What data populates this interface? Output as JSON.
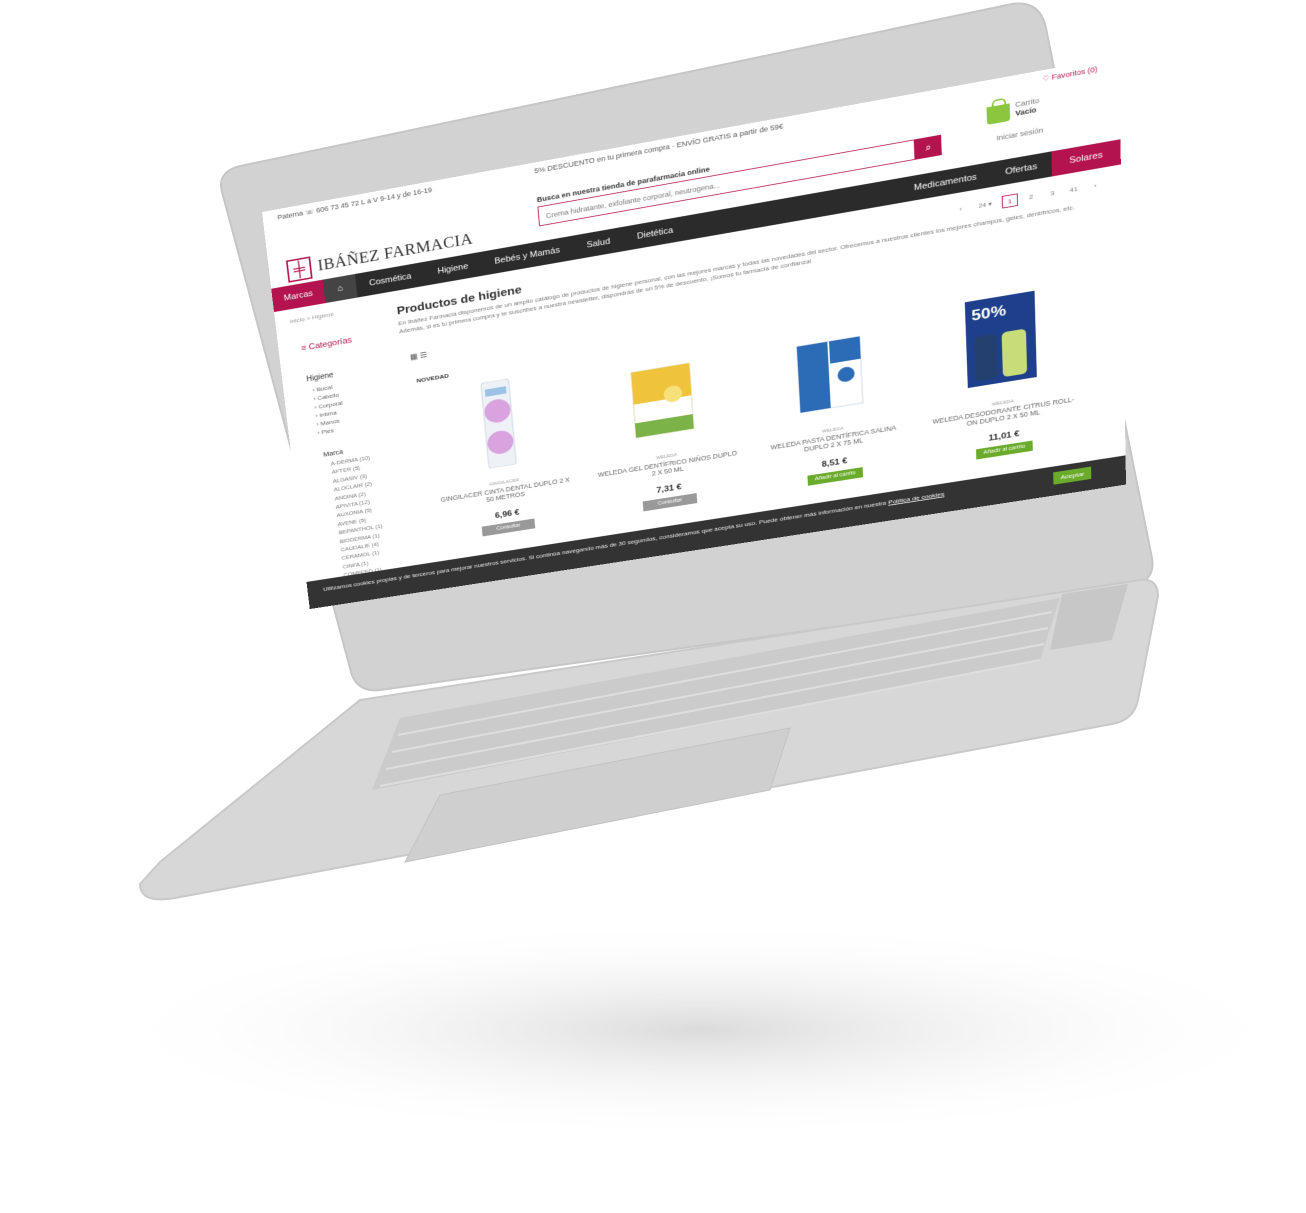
{
  "topbar": {
    "phone": "Paterna ☏ 606 73 45 72 L a V 9-14 y de 16-19",
    "promo": "5% DESCUENTO en tu primera compra · ENVÍO GRATIS a partir de 59€",
    "favorites": "♡ Favoritos (0)"
  },
  "logo": {
    "mark": "╪",
    "text": "IBÁÑEZ FARMACIA"
  },
  "search": {
    "label": "Busca en nuestra tienda de parafarmacia online",
    "placeholder": "Crema hidratante, exfoliante corporal, neutrogena...",
    "button_icon": "search-icon"
  },
  "cart": {
    "title": "Carrito",
    "value": "Vacío",
    "login": "Iniciar sesión"
  },
  "nav": {
    "brands": "Marcas",
    "home_icon": "home-icon",
    "items": [
      "Cosmética",
      "Higiene",
      "Bebés y Mamás",
      "Salud",
      "Dietética"
    ],
    "medicamentos": "Medicamentos",
    "ofertas": "Ofertas",
    "solares": "Solares"
  },
  "breadcrumb": "Inicio  >  Higiene",
  "categories_title": "Categorías",
  "sidebar": {
    "head": "Higiene",
    "items": [
      "Bucal",
      "Cabello",
      "Corporal",
      "Intima",
      "Manos",
      "Pies"
    ]
  },
  "brands": {
    "head": "Marca",
    "items": [
      "A-DERMA (10)",
      "AFTER (5)",
      "ALGASIV (3)",
      "ALOCLAIR (2)",
      "ANDINA (2)",
      "APIVITA (12)",
      "AUXONIA (5)",
      "AVENE (5)",
      "BEPANTHOL (1)",
      "BIODERMA (1)",
      "CAUDALIE (4)",
      "CERAMOL (1)",
      "CINFA (1)",
      "COMFEED (1)"
    ]
  },
  "page": {
    "title": "Productos de higiene",
    "desc": "En Ibáñez Farmacia disponemos de un amplio catálogo de productos de higiene personal, con las mejores marcas y todas las novedades del sector. Ofrecemos a nuestros clientes los mejores champús, geles, dentífricos, etc. Además, si es tu primera compra y te suscribes a nuestra newsletter, dispondrás de un 5% de descuento. ¡Somos tu farmacia de confianza!"
  },
  "pagination": [
    "‹",
    "24 ▾",
    "1",
    "2",
    "3",
    "41",
    "›"
  ],
  "view_icons": "▦ ☰",
  "novedad": "NOVEDAD",
  "products": [
    {
      "brand": "GINGILACER",
      "name": "GINGILACER CINTA DENTAL DUPLO 2 X 50 METROS",
      "ref": "",
      "price": "6,96 €",
      "button": "Consultar",
      "color": "#d9a3e0"
    },
    {
      "brand": "WELEDA",
      "name": "WELEDA GEL DENTÍFRICO NIÑOS DUPLO 2 X 50 ML",
      "ref": "",
      "price": "7,31 €",
      "button": "Consultar",
      "color": "#f0c33c"
    },
    {
      "brand": "WELEDA",
      "name": "WELEDA PASTA DENTÍFRICA SALINA DUPLO 2 X 75 ML",
      "ref": "",
      "price": "8,51 €",
      "button": "Añadir al carrito",
      "color": "#2c6bb5"
    },
    {
      "brand": "WELEDA",
      "name": "WELEDA DESODORANTE CITRUS ROLL-ON DUPLO 2 X 50 ML",
      "ref": "",
      "price": "11,01 €",
      "button": "Añadir al carrito",
      "color": "#1e3f8c"
    }
  ],
  "cookie": {
    "text": "Utilizamos cookies propias y de terceros para mejorar nuestros servicios. Si continúa navegando más de 30 segundos, consideramos que acepta su uso. Puede obtener más información en nuestra",
    "link": "Política de cookies",
    "accept": "Aceptar"
  },
  "colors": {
    "brand": "#b3134e",
    "nav": "#2b2b2b",
    "accent_green": "#6aab2c",
    "laptop_body": "#d4d4d4"
  }
}
